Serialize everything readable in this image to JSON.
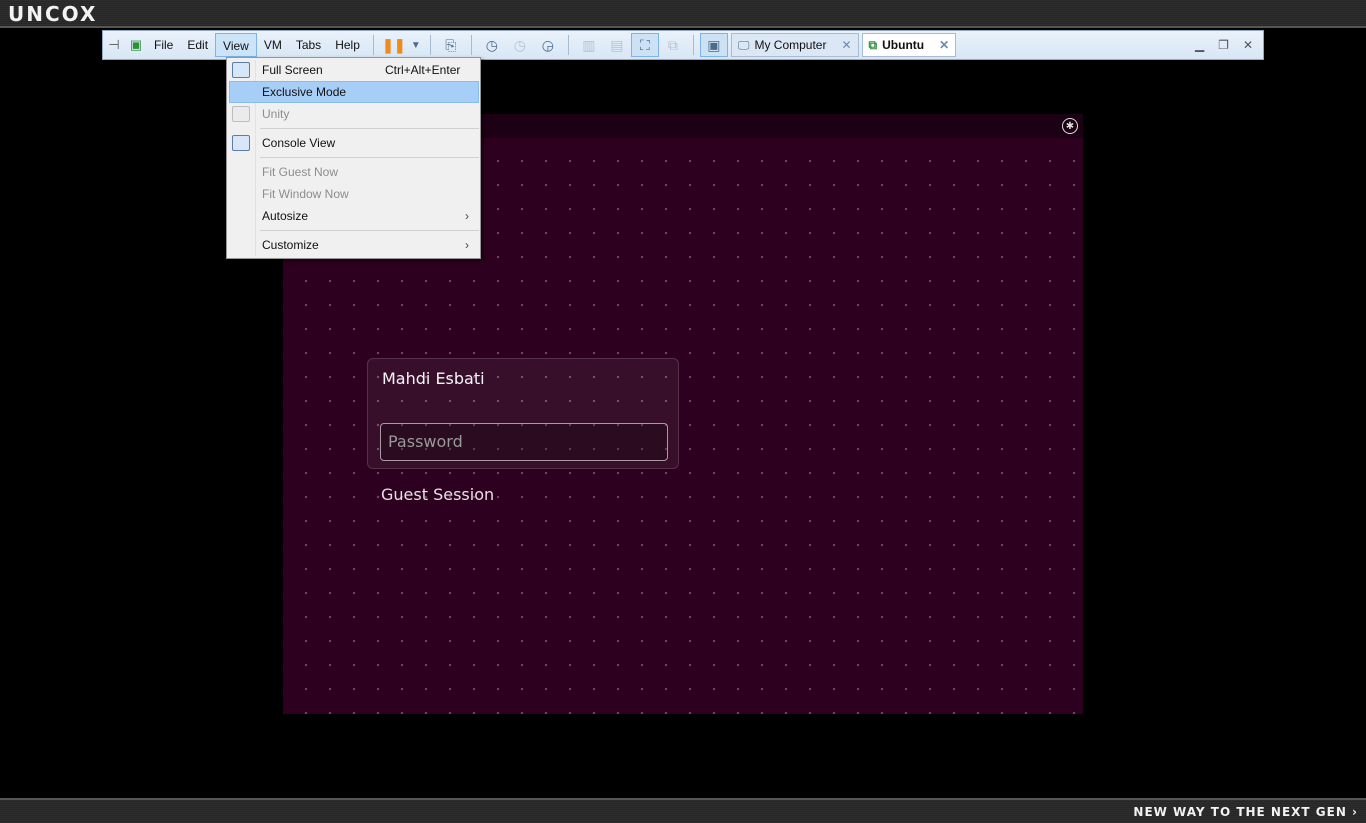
{
  "host": {
    "logo": "UNCOX",
    "tagline": "NEW WAY TO THE NEXT GEN ›"
  },
  "toolbar": {
    "menus": [
      "File",
      "Edit",
      "View",
      "VM",
      "Tabs",
      "Help"
    ],
    "active_menu": "View",
    "tabs": [
      {
        "label": "My Computer",
        "icon": "computer-icon",
        "active": false
      },
      {
        "label": "Ubuntu",
        "icon": "vm-running-icon",
        "active": true
      }
    ]
  },
  "view_menu": {
    "items": [
      {
        "label": "Full Screen",
        "shortcut": "Ctrl+Alt+Enter",
        "icon": "fullscreen-icon",
        "disabled": false
      },
      {
        "label": "Exclusive Mode",
        "highlighted": true,
        "disabled": false
      },
      {
        "label": "Unity",
        "icon": "unity-icon",
        "disabled": true
      },
      {
        "label": "Console View",
        "icon": "console-view-icon",
        "disabled": false
      },
      {
        "label": "Fit Guest Now",
        "disabled": true
      },
      {
        "label": "Fit Window Now",
        "disabled": true
      },
      {
        "label": "Autosize",
        "submenu": true,
        "disabled": false
      },
      {
        "label": "Customize",
        "submenu": true,
        "disabled": false
      }
    ]
  },
  "guest": {
    "user_name": "Mahdi Esbati",
    "password_placeholder": "Password",
    "guest_session": "Guest Session"
  },
  "colors": {
    "guest_bg": "#2c001e",
    "menu_highlight": "#a6cef7",
    "pause_accent": "#f08a18"
  }
}
